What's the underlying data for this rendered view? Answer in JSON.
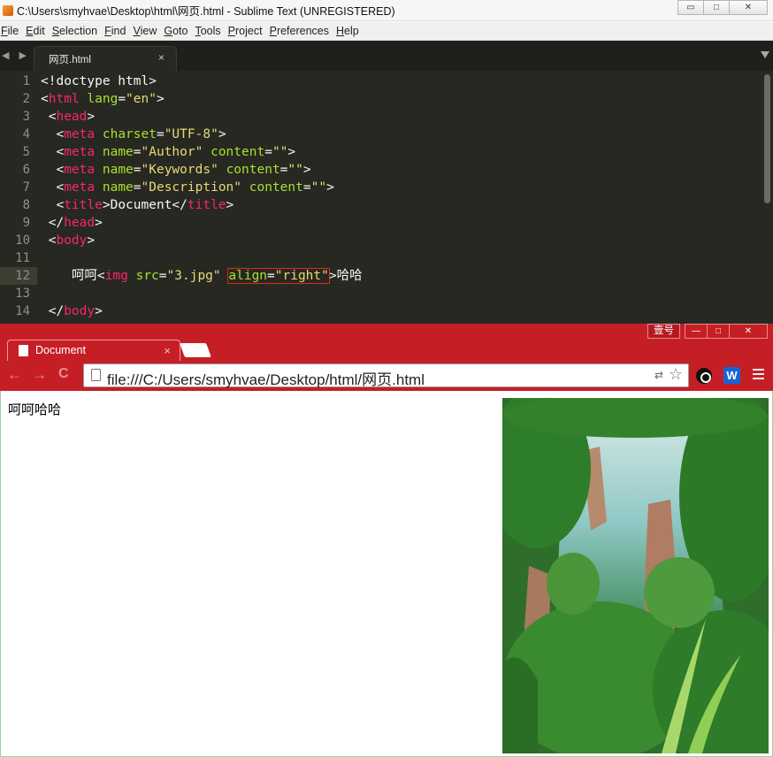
{
  "sublime": {
    "title": "C:\\Users\\smyhvae\\Desktop\\html\\网页.html - Sublime Text (UNREGISTERED)",
    "menu": [
      "File",
      "Edit",
      "Selection",
      "Find",
      "View",
      "Goto",
      "Tools",
      "Project",
      "Preferences",
      "Help"
    ],
    "tab_label": "网页.html",
    "tab_close": "×",
    "nav_arrows": "◀ ▶",
    "window_buttons": {
      "minimize": "▭",
      "maximize": "□",
      "close": "✕"
    },
    "line_numbers": [
      "1",
      "2",
      "3",
      "4",
      "5",
      "6",
      "7",
      "8",
      "9",
      "10",
      "11",
      "12",
      "13",
      "14"
    ],
    "current_line": "12"
  },
  "chrome": {
    "user_button": "壹号",
    "window_buttons": {
      "minimize": "—",
      "maximize": "□",
      "close": "✕"
    },
    "tab_label": "Document",
    "tab_close": "×",
    "back_icon": "←",
    "forward_icon": "→",
    "reload_icon": "C",
    "url": "file:///C:/Users/smyhvae/Desktop/html/网页.html",
    "extension_w": "W",
    "page_text": "呵呵哈哈",
    "image_description_icon": "landscape-photo"
  },
  "colors": {
    "editor_bg": "#272822",
    "tag": "#f92672",
    "attr": "#a6e22e",
    "string": "#e6db74",
    "chrome_frame": "#c51f25",
    "highlight_box": "#e8251e"
  }
}
